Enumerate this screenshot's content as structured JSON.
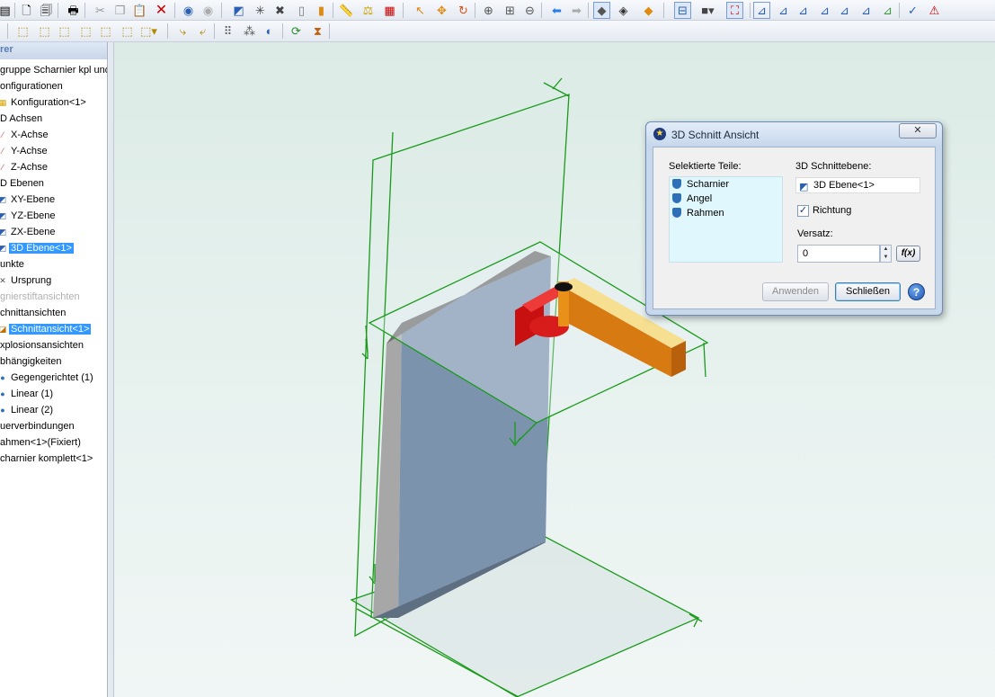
{
  "explorer": {
    "header": "rer",
    "items": [
      {
        "label": "gruppe Scharnier kpl und",
        "icon": "",
        "indent": 0
      },
      {
        "label": "onfigurationen",
        "icon": "",
        "indent": 0
      },
      {
        "label": "Konfiguration<1>",
        "icon": "configuration-icon",
        "indent": 1
      },
      {
        "label": "D Achsen",
        "icon": "",
        "indent": 0
      },
      {
        "label": "X-Achse",
        "icon": "axis-icon",
        "indent": 1
      },
      {
        "label": "Y-Achse",
        "icon": "axis-icon",
        "indent": 1
      },
      {
        "label": "Z-Achse",
        "icon": "axis-icon",
        "indent": 1
      },
      {
        "label": "D Ebenen",
        "icon": "",
        "indent": 0
      },
      {
        "label": "XY-Ebene",
        "icon": "plane-icon",
        "indent": 1
      },
      {
        "label": "YZ-Ebene",
        "icon": "plane-icon",
        "indent": 1
      },
      {
        "label": "ZX-Ebene",
        "icon": "plane-icon",
        "indent": 1
      },
      {
        "label": "3D Ebene<1>",
        "icon": "plane-icon",
        "indent": 1,
        "selected": true
      },
      {
        "label": "unkte",
        "icon": "",
        "indent": 0
      },
      {
        "label": "Ursprung",
        "icon": "origin-icon",
        "indent": 1
      },
      {
        "label": "gnierstiftansichten",
        "icon": "",
        "indent": 0,
        "grey": true
      },
      {
        "label": "chnittansichten",
        "icon": "",
        "indent": 0
      },
      {
        "label": "Schnittansicht<1>",
        "icon": "section-view-icon",
        "indent": 1,
        "selected": true
      },
      {
        "label": "xplosionsansichten",
        "icon": "",
        "indent": 0
      },
      {
        "label": "bhängigkeiten",
        "icon": "",
        "indent": 0
      },
      {
        "label": "Gegengerichtet (1)",
        "icon": "constraint-icon",
        "indent": 1
      },
      {
        "label": "Linear (1)",
        "icon": "constraint-icon",
        "indent": 1
      },
      {
        "label": "Linear (2)",
        "icon": "constraint-icon",
        "indent": 1
      },
      {
        "label": "uerverbindungen",
        "icon": "",
        "indent": 0
      },
      {
        "label": "ahmen<1>(Fixiert)",
        "icon": "",
        "indent": 0
      },
      {
        "label": "charnier komplett<1>",
        "icon": "",
        "indent": 0
      }
    ]
  },
  "dialog": {
    "title": "3D Schnitt Ansicht",
    "close_label": "✕",
    "parts_label": "Selektierte Teile:",
    "parts": [
      "Scharnier",
      "Angel",
      "Rahmen"
    ],
    "plane_label": "3D Schnittebene:",
    "plane_value": "3D Ebene<1>",
    "direction_label": "Richtung",
    "direction_checked": true,
    "offset_label": "Versatz:",
    "offset_value": "0",
    "fx_label": "f(x)",
    "apply_label": "Anwenden",
    "close_button_label": "Schließen",
    "help_label": "?"
  },
  "colors": {
    "plane_lines": "#1a9a1a",
    "frame_face": "#7b93ad",
    "frame_edge": "#a6a6a6",
    "hinge_arm": "#d77c12",
    "hinge_arm_top": "#f7de8c",
    "hinge_block": "#e01818",
    "selection": "#3399ff"
  }
}
